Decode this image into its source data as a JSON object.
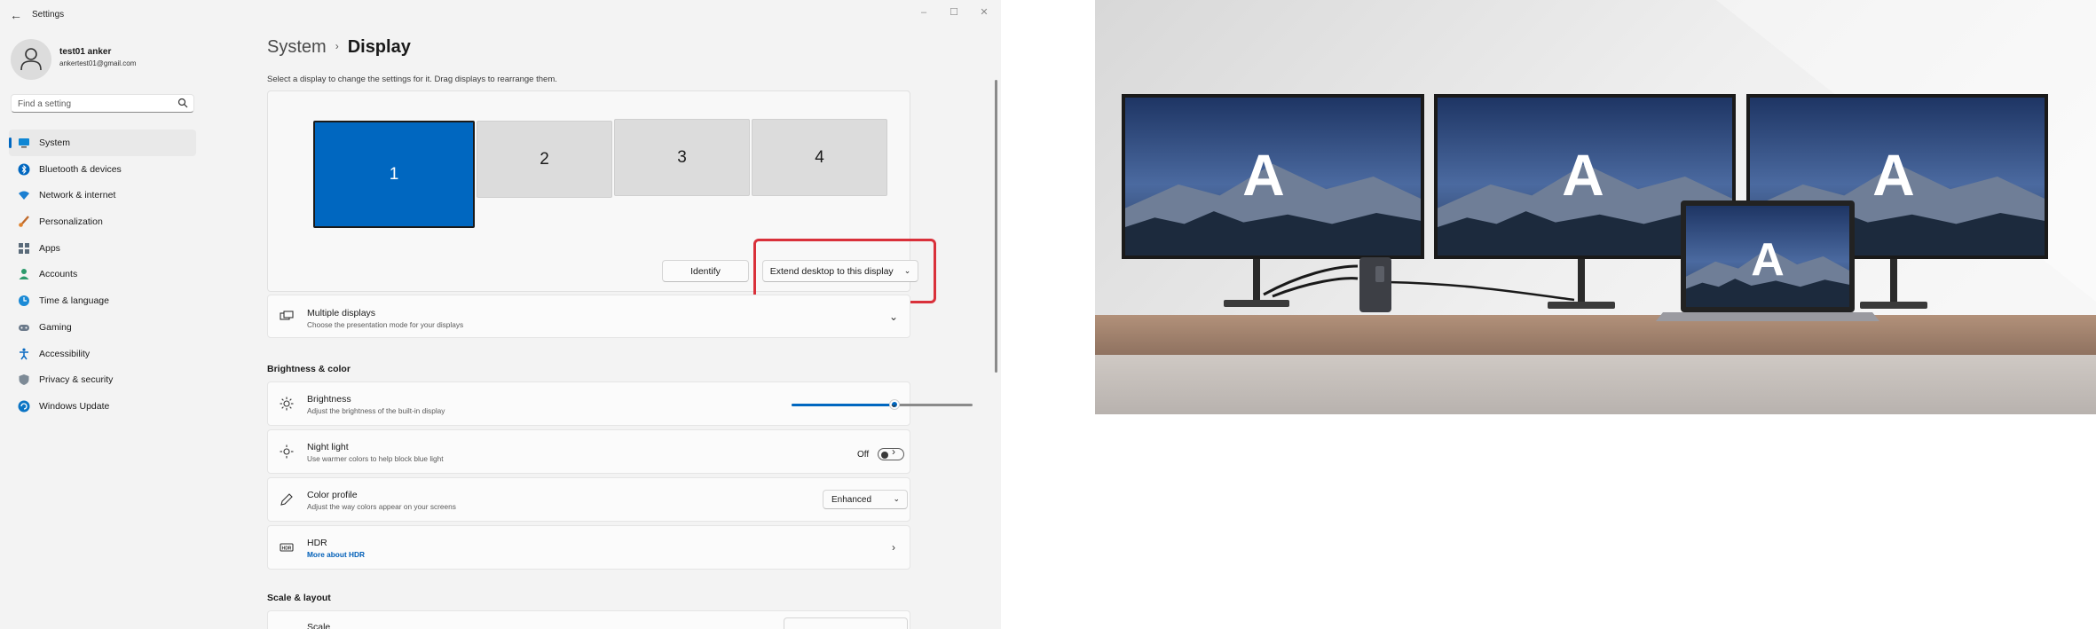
{
  "window": {
    "app_title": "Settings",
    "back_glyph": "←",
    "controls": [
      "–",
      "☐",
      "✕"
    ]
  },
  "user": {
    "name": "test01 anker",
    "email": "ankertest01@gmail.com"
  },
  "search": {
    "placeholder": "Find a setting"
  },
  "nav": [
    {
      "label": "System",
      "icon": "monitor-icon",
      "active": true
    },
    {
      "label": "Bluetooth & devices",
      "icon": "bluetooth-icon"
    },
    {
      "label": "Network & internet",
      "icon": "wifi-icon"
    },
    {
      "label": "Personalization",
      "icon": "brush-icon"
    },
    {
      "label": "Apps",
      "icon": "apps-icon"
    },
    {
      "label": "Accounts",
      "icon": "person-icon"
    },
    {
      "label": "Time & language",
      "icon": "globe-clock-icon"
    },
    {
      "label": "Gaming",
      "icon": "gamepad-icon"
    },
    {
      "label": "Accessibility",
      "icon": "accessibility-icon"
    },
    {
      "label": "Privacy & security",
      "icon": "shield-icon"
    },
    {
      "label": "Windows Update",
      "icon": "update-icon"
    }
  ],
  "breadcrumb": {
    "parent": "System",
    "separator": "›",
    "current": "Display"
  },
  "description": "Select a display to change the settings for it. Drag displays to rearrange them.",
  "displays": {
    "monitors": [
      "1",
      "2",
      "3",
      "4"
    ],
    "selected": "1"
  },
  "identify_button": "Identify",
  "extend_dropdown": {
    "value": "Extend desktop to this display",
    "chevron": "⌄"
  },
  "multiple_displays": {
    "title": "Multiple displays",
    "desc": "Choose the presentation mode for your displays",
    "chevron": "⌄"
  },
  "section_brightness": "Brightness & color",
  "brightness": {
    "title": "Brightness",
    "desc": "Adjust the brightness of the built-in display",
    "level_percent": 57,
    "chevron": "⌄"
  },
  "night_light": {
    "title": "Night light",
    "desc": "Use warmer colors to help block blue light",
    "state": "Off",
    "chevron": "›"
  },
  "color_profile": {
    "title": "Color profile",
    "desc": "Adjust the way colors appear on your screens",
    "value": "Enhanced",
    "chevron": "⌄"
  },
  "hdr": {
    "title": "HDR",
    "link": "More about HDR",
    "chevron": "›"
  },
  "section_scale": "Scale & layout",
  "scale": {
    "title": "Scale"
  },
  "photo": {
    "screen_letter": "A"
  },
  "colors": {
    "accent": "#0067c0",
    "highlight_box": "#d9303a",
    "sidebar_bg": "#f3f3f3"
  }
}
